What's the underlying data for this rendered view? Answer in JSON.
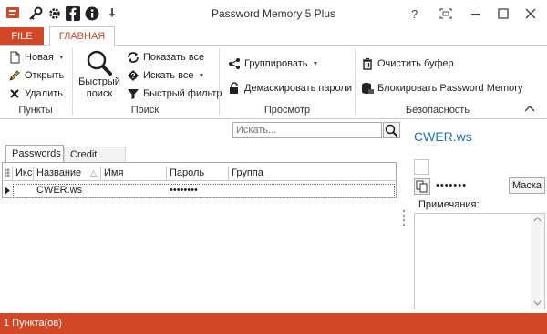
{
  "app": {
    "title": "Password Memory 5 Plus",
    "quick_access": [
      "key-icon",
      "gear-icon",
      "facebook-icon",
      "info-icon",
      "pin-icon"
    ]
  },
  "tabs": {
    "file": "FILE",
    "home": "ГЛАВНАЯ"
  },
  "ribbon": {
    "items_group": {
      "label": "Пункты",
      "new": "Новая",
      "open": "Открыть",
      "delete": "Удалить"
    },
    "search_group": {
      "label": "Поиск",
      "quick_search_line1": "Быстрый",
      "quick_search_line2": "поиск",
      "show_all": "Показать все",
      "search_all": "Искать все",
      "quick_filter": "Быстрый фильтр"
    },
    "view_group": {
      "label": "Просмотр",
      "group": "Группировать",
      "unmask": "Демаскировать пароли"
    },
    "security_group": {
      "label": "Безопасность",
      "clear_buffer": "Очистить буфер",
      "lock": "Блокировать Password Memory"
    }
  },
  "search": {
    "placeholder": "Искать..."
  },
  "subtabs": {
    "passwords": "Passwords",
    "cards": "Credit Cards"
  },
  "grid": {
    "columns": [
      "Икс",
      "Название",
      "Имя",
      "Пароль",
      "Группа"
    ],
    "sort_indicator": "△",
    "rows": [
      {
        "name": "CWER.ws",
        "user": "",
        "password": "••••••••",
        "group": ""
      }
    ]
  },
  "details": {
    "title": "CWER.ws",
    "password": "•••••••",
    "mask_label": "Маска",
    "notes_label": "Примечания:"
  },
  "status": {
    "text": "1 Пункта(ов)"
  },
  "colors": {
    "accent": "#d24726",
    "link": "#1e73be"
  }
}
